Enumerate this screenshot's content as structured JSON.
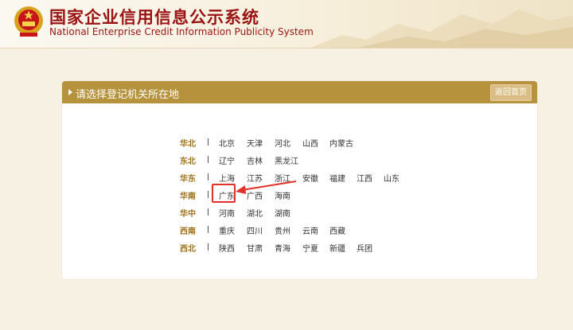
{
  "header": {
    "title_cn": "国家企业信用信息公示系统",
    "title_en": "National Enterprise Credit Information Publicity System"
  },
  "panel": {
    "title": "请选择登记机关所在地",
    "back_label": "返回首页"
  },
  "regions": [
    {
      "name": "华北",
      "provinces": [
        "北京",
        "天津",
        "河北",
        "山西",
        "内蒙古"
      ]
    },
    {
      "name": "东北",
      "provinces": [
        "辽宁",
        "吉林",
        "黑龙江"
      ]
    },
    {
      "name": "华东",
      "provinces": [
        "上海",
        "江苏",
        "浙江",
        "安徽",
        "福建",
        "江西",
        "山东"
      ]
    },
    {
      "name": "华南",
      "provinces": [
        "广东",
        "广西",
        "海南"
      ]
    },
    {
      "name": "华中",
      "provinces": [
        "河南",
        "湖北",
        "湖南"
      ]
    },
    {
      "name": "西南",
      "provinces": [
        "重庆",
        "四川",
        "贵州",
        "云南",
        "西藏"
      ]
    },
    {
      "name": "西北",
      "provinces": [
        "陕西",
        "甘肃",
        "青海",
        "宁夏",
        "新疆",
        "兵团"
      ]
    }
  ],
  "highlight": {
    "region": "华南",
    "province": "广东",
    "color": "#e0322b"
  },
  "colors": {
    "accent": "#b7923c",
    "title": "#9a1313",
    "region": "#a0701a"
  }
}
